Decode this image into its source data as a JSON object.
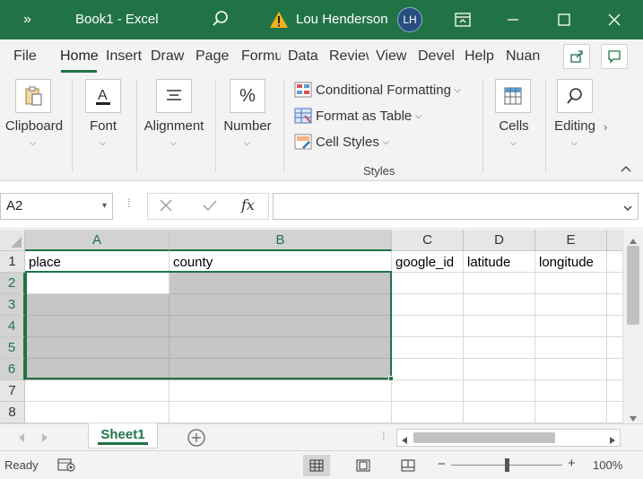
{
  "titlebar": {
    "quick_access": "»",
    "doc_title": "Book1  -  Excel",
    "user_name": "Lou Henderson",
    "user_initials": "LH"
  },
  "ribbon_tabs": [
    "File",
    "Home",
    "Insert",
    "Draw",
    "Page",
    "Formu",
    "Data",
    "Review",
    "View",
    "Devel",
    "Help",
    "Nuan"
  ],
  "ribbon": {
    "clipboard": "Clipboard",
    "font": "Font",
    "alignment": "Alignment",
    "number": "Number",
    "number_icon": "%",
    "conditional_formatting": "Conditional Formatting",
    "format_as_table": "Format as Table",
    "cell_styles": "Cell Styles",
    "styles_group": "Styles",
    "cells": "Cells",
    "editing": "Editing"
  },
  "formula_bar": {
    "name_box": "A2",
    "fx_symbol": "fx",
    "formula": ""
  },
  "grid": {
    "columns": [
      "A",
      "B",
      "C",
      "D",
      "E"
    ],
    "rows": [
      "1",
      "2",
      "3",
      "4",
      "5",
      "6",
      "7",
      "8"
    ],
    "header_cells": [
      "place",
      "county",
      "google_id",
      "latitude",
      "longitude"
    ]
  },
  "sheets": [
    "Sheet1"
  ],
  "status": {
    "ready": "Ready",
    "zoom": "100%",
    "zoom_level": 1.0,
    "minus": "−",
    "plus": "+"
  },
  "colors": {
    "accent": "#217346",
    "selection_fill": "#c6c6c6"
  }
}
